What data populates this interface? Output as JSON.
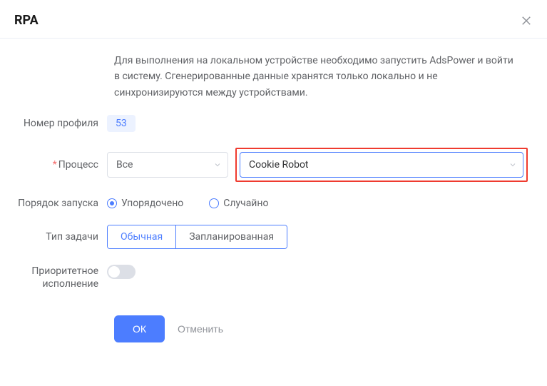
{
  "header": {
    "title": "RPA"
  },
  "intro": "Для выполнения на локальном устройстве необходимо запустить AdsPower и войти в систему. Сгенерированные данные хранятся только локально и не синхронизируются между устройствами.",
  "labels": {
    "profile_number": "Номер профиля",
    "process": "Процесс",
    "launch_order": "Порядок запуска",
    "task_type": "Тип задачи",
    "priority_exec": "Приоритетное исполнение"
  },
  "values": {
    "profile_number": "53",
    "group_select": "Все",
    "process_select": "Cookie Robot"
  },
  "radios": {
    "ordered": "Упорядочено",
    "random": "Случайно"
  },
  "segments": {
    "normal": "Обычная",
    "scheduled": "Запланированная"
  },
  "buttons": {
    "ok": "ОК",
    "cancel": "Отменить"
  }
}
